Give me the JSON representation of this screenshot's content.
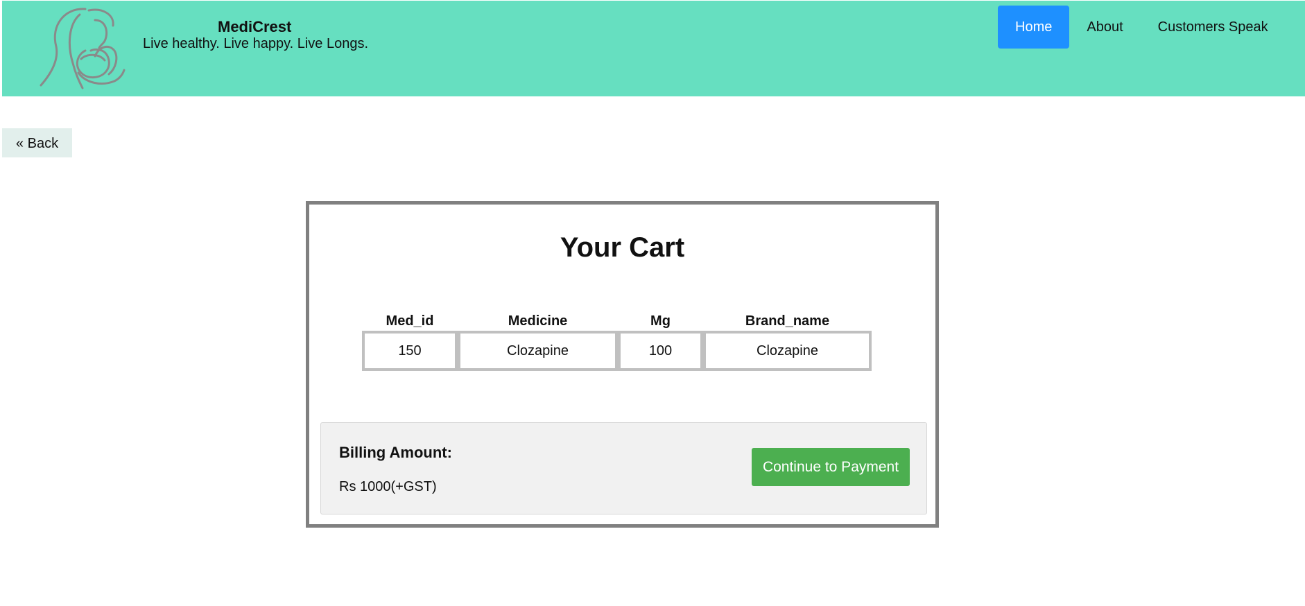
{
  "header": {
    "brand_name": "MediCrest",
    "tagline": "Live healthy. Live happy. Live Longs.",
    "logo_icon": "mother-and-child-logo",
    "background_color": "#66dfc0"
  },
  "nav": {
    "items": [
      {
        "label": "Home",
        "active": true
      },
      {
        "label": "About",
        "active": false
      },
      {
        "label": "Customers Speak",
        "active": false
      }
    ],
    "active_color": "#1e90ff"
  },
  "back_button": {
    "label": "« Back"
  },
  "cart": {
    "title": "Your Cart",
    "columns": [
      "Med_id",
      "Medicine",
      "Mg",
      "Brand_name"
    ],
    "rows": [
      [
        "150",
        "Clozapine",
        "100",
        "Clozapine"
      ]
    ]
  },
  "billing": {
    "label": "Billing Amount:",
    "amount": "Rs 1000(+GST)",
    "pay_button_label": "Continue to Payment",
    "pay_button_color": "#4caf50"
  }
}
